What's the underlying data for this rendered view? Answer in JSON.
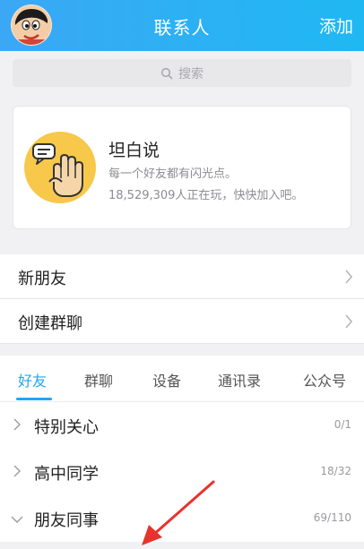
{
  "header": {
    "title": "联系人",
    "add_label": "添加"
  },
  "search": {
    "placeholder": "搜索"
  },
  "card": {
    "title": "坦白说",
    "subtitle": "每一个好友都有闪光点。",
    "players_text": "18,529,309人正在玩，快快加入吧。"
  },
  "menu": {
    "items": [
      {
        "label": "新朋友"
      },
      {
        "label": "创建群聊"
      }
    ]
  },
  "tabs": [
    {
      "label": "好友"
    },
    {
      "label": "群聊"
    },
    {
      "label": "设备"
    },
    {
      "label": "通讯录"
    },
    {
      "label": "公众号"
    }
  ],
  "active_tab": "好友",
  "groups": [
    {
      "label": "特别关心",
      "count": "0/1",
      "expanded": false
    },
    {
      "label": "高中同学",
      "count": "18/32",
      "expanded": false
    },
    {
      "label": "朋友同事",
      "count": "69/110",
      "expanded": true
    }
  ],
  "colors": {
    "accent": "#23a4f0",
    "header_gradient_start": "#3ba8f5",
    "header_gradient_end": "#1fb8f3",
    "annotation_arrow": "#e8322d"
  },
  "icons": {
    "avatar": "cartoon-avatar",
    "search": "search-icon",
    "card": "hand-speech-bubble-icon",
    "menu_chevron": "chevron-right-icon",
    "group_collapsed": "chevron-right-icon",
    "group_expanded": "chevron-down-icon"
  }
}
